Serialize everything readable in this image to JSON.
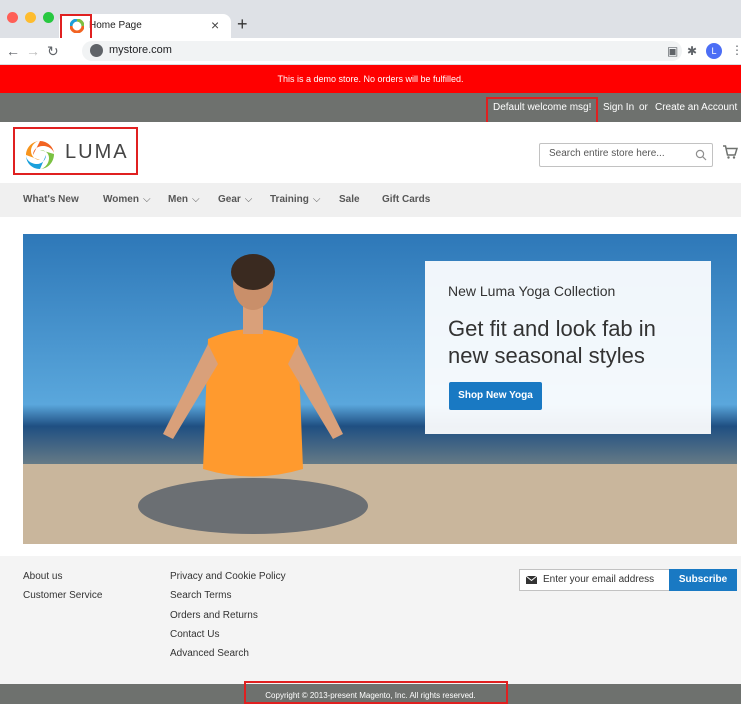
{
  "browser": {
    "tab_title": "Home Page",
    "tab_close": "×",
    "new_tab": "+",
    "url": "mystore.com",
    "avatar_letter": "L",
    "traffic_lights": [
      "#ff5f57",
      "#febc2e",
      "#28c840"
    ]
  },
  "demo_notice": "This is a demo store. No orders will be fulfilled.",
  "header_panel": {
    "welcome": "Default welcome msg!",
    "sign_in": "Sign In",
    "or": "or",
    "create_account": "Create an Account"
  },
  "logo": {
    "text": "LUMA"
  },
  "search": {
    "placeholder": "Search entire store here..."
  },
  "nav": {
    "items": [
      {
        "label": "What's New",
        "has_dropdown": false
      },
      {
        "label": "Women",
        "has_dropdown": true
      },
      {
        "label": "Men",
        "has_dropdown": true
      },
      {
        "label": "Gear",
        "has_dropdown": true
      },
      {
        "label": "Training",
        "has_dropdown": true
      },
      {
        "label": "Sale",
        "has_dropdown": false
      },
      {
        "label": "Gift Cards",
        "has_dropdown": false
      }
    ],
    "caret": "⌵"
  },
  "hero": {
    "subtitle": "New Luma Yoga Collection",
    "title": "Get fit and look fab in new seasonal styles",
    "button": "Shop New Yoga"
  },
  "footer": {
    "col1": [
      "About us",
      "Customer Service"
    ],
    "col2": [
      "Privacy and Cookie Policy",
      "Search Terms",
      "Orders and Returns",
      "Contact Us",
      "Advanced Search"
    ],
    "newsletter_placeholder": "Enter your email address",
    "subscribe": "Subscribe",
    "copyright": "Copyright © 2013-present Magento, Inc. All rights reserved."
  },
  "colors": {
    "demo_bar": "#ff0000",
    "panel": "#6e716e",
    "primary_button": "#1979c3",
    "annotation": "#e02020"
  }
}
